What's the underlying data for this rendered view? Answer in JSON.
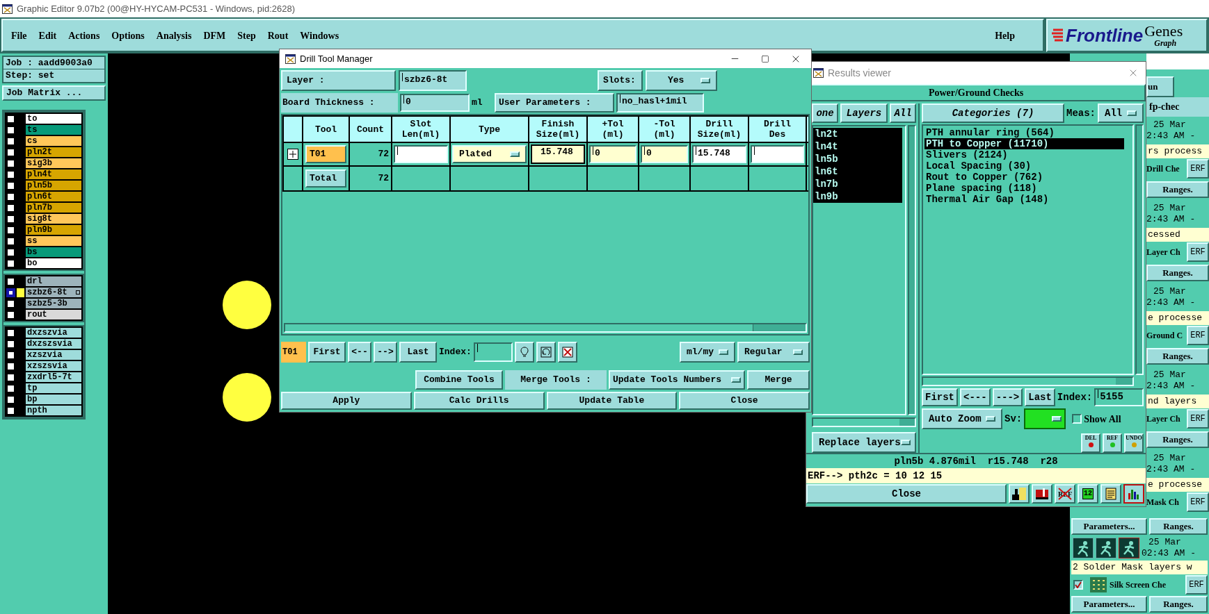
{
  "app": {
    "title": "Graphic Editor 9.07b2 (00@HY-HYCAM-PC531 - Windows, pid:2628)"
  },
  "menu": [
    "File",
    "Edit",
    "Actions",
    "Options",
    "Analysis",
    "DFM",
    "Step",
    "Rout",
    "Windows"
  ],
  "help": "Help",
  "logo": {
    "brand": "Frontline",
    "product": "Genes",
    "subtitle": "Graph"
  },
  "job": {
    "job": "Job : aadd9003a0",
    "step": "Step: set",
    "matrix": "Job Matrix ..."
  },
  "layer_groups": [
    {
      "layers": [
        {
          "name": "to",
          "color": "#ffffff",
          "selected": false,
          "displayed": false
        },
        {
          "name": "ts",
          "color": "#079a7a",
          "selected": false,
          "displayed": false
        },
        {
          "name": "cs",
          "color": "#ffc75a",
          "selected": false,
          "displayed": false
        },
        {
          "name": "pln2t",
          "color": "#d6a500",
          "selected": false,
          "displayed": false
        },
        {
          "name": "sig3b",
          "color": "#ffc75a",
          "selected": false,
          "displayed": false
        },
        {
          "name": "pln4t",
          "color": "#d6a500",
          "selected": false,
          "displayed": false
        },
        {
          "name": "pln5b",
          "color": "#d6a500",
          "selected": false,
          "displayed": false
        },
        {
          "name": "pln6t",
          "color": "#d6a500",
          "selected": false,
          "displayed": false
        },
        {
          "name": "pln7b",
          "color": "#d6a500",
          "selected": false,
          "displayed": false
        },
        {
          "name": "sig8t",
          "color": "#ffc75a",
          "selected": false,
          "displayed": false
        },
        {
          "name": "pln9b",
          "color": "#d6a500",
          "selected": false,
          "displayed": false
        },
        {
          "name": "ss",
          "color": "#ffc75a",
          "selected": false,
          "displayed": false
        },
        {
          "name": "bs",
          "color": "#079a7a",
          "selected": false,
          "displayed": false
        },
        {
          "name": "bo",
          "color": "#ffffff",
          "selected": false,
          "displayed": false
        }
      ]
    },
    {
      "layers": [
        {
          "name": "drl",
          "color": "#9db3bb",
          "selected": false,
          "displayed": false
        },
        {
          "name": "szbz6-8t",
          "color": "#9db3bb",
          "selected": true,
          "displayed": true
        },
        {
          "name": "szbz5-3b",
          "color": "#9db3bb",
          "selected": false,
          "displayed": false
        },
        {
          "name": "rout",
          "color": "#d9d9d9",
          "selected": false,
          "displayed": false
        }
      ]
    },
    {
      "layers": [
        {
          "name": "dxzszvia",
          "color": "#9edcdb",
          "selected": false,
          "displayed": false
        },
        {
          "name": "dxzszsvia",
          "color": "#9edcdb",
          "selected": false,
          "displayed": false
        },
        {
          "name": "xzszvia",
          "color": "#9edcdb",
          "selected": false,
          "displayed": false
        },
        {
          "name": "xzszsvia",
          "color": "#9edcdb",
          "selected": false,
          "displayed": false
        },
        {
          "name": "zxdrl5-7t",
          "color": "#9edcdb",
          "selected": false,
          "displayed": false
        },
        {
          "name": "tp",
          "color": "#9edcdb",
          "selected": false,
          "displayed": false
        },
        {
          "name": "bp",
          "color": "#9edcdb",
          "selected": false,
          "displayed": false
        },
        {
          "name": "npth",
          "color": "#9edcdb",
          "selected": false,
          "displayed": false
        }
      ]
    }
  ],
  "drill_tool_manager": {
    "title": "Drill Tool Manager",
    "layer_label": "Layer :",
    "layer": "szbz6-8t",
    "slots_label": "Slots:",
    "slots": "Yes",
    "thickness_label": "Board Thickness :",
    "thickness": "0",
    "thickness_unit": "ml",
    "user_params_label": "User Parameters :",
    "user_params": "no_hasl+1mil",
    "columns": [
      "Tool",
      "Count",
      "Slot\nLen(ml)",
      "Type",
      "Finish\nSize(ml)",
      "+Tol\n(ml)",
      "-Tol\n(ml)",
      "Drill\nSize(ml)",
      "Drill\nDes"
    ],
    "rows": [
      {
        "kind": "tool",
        "tool": "T01",
        "count": "72",
        "type": "Plated",
        "finish": "15.748",
        "plus_tol": "0",
        "minus_tol": "0",
        "drill_size": "15.748"
      },
      {
        "kind": "total",
        "tool": "Total",
        "count": "72"
      }
    ],
    "current": "T01",
    "nav": [
      "First",
      "<--",
      "-->",
      "Last"
    ],
    "index_label": "Index:",
    "units": "ml/my",
    "mode": "Regular",
    "combine": "Combine Tools",
    "merge_label": "Merge Tools :",
    "merge_mode": "Update Tools Numbers",
    "merge": "Merge",
    "actions": [
      "Apply",
      "Calc Drills",
      "Update Table",
      "Close"
    ]
  },
  "results_viewer": {
    "title": "Results viewer",
    "heading": "Power/Ground Checks",
    "layer_buttons": [
      "one",
      "Layers",
      "All"
    ],
    "layers": [
      {
        "name": "ln2t",
        "selected": true
      },
      {
        "name": "ln4t",
        "selected": true
      },
      {
        "name": "ln5b",
        "selected": true
      },
      {
        "name": "ln6t",
        "selected": true
      },
      {
        "name": "ln7b",
        "selected": true
      },
      {
        "name": "ln9b",
        "selected": true
      }
    ],
    "categories_button": "Categories (7)",
    "meas_label": "Meas:",
    "meas": "All",
    "categories": [
      {
        "label": "PTH annular ring (564)",
        "selected": false
      },
      {
        "label": "PTH to Copper (11710)",
        "selected": true
      },
      {
        "label": "Slivers (2124)",
        "selected": false
      },
      {
        "label": "Local Spacing (30)",
        "selected": false
      },
      {
        "label": "Rout to Copper (762)",
        "selected": false
      },
      {
        "label": "Plane spacing (118)",
        "selected": false
      },
      {
        "label": "Thermal Air Gap (148)",
        "selected": false
      }
    ],
    "nav": [
      "First",
      "<---",
      "--->",
      "Last"
    ],
    "index_label": "Index:",
    "index": "5155",
    "zoom_mode": "Auto Zoom",
    "sv_label": "Sv:",
    "show_all": {
      "label": "Show All",
      "checked": false
    },
    "tool_buttons": [
      "DEL",
      "REF",
      "UNDO"
    ],
    "replace": "Replace layers",
    "status": "pln5b 4.876mil  r15.748  r28",
    "erf": "ERF--> pth2c = 10 12 15",
    "close": "Close",
    "icon_texts": [
      "REF",
      "12"
    ]
  },
  "checks_panel": {
    "tab": "un",
    "title": "fp-chec",
    "upper_items": [
      {
        "kind": "date",
        "date": "25 Mar",
        "time": "2:43 AM -"
      },
      {
        "kind": "message",
        "text": "rs process"
      },
      {
        "kind": "check",
        "name": "Drill Che",
        "erf": "ERF"
      },
      {
        "kind": "ranges",
        "ranges": "Ranges."
      },
      {
        "kind": "date",
        "date": "25 Mar",
        "time": "2:43 AM -"
      },
      {
        "kind": "message",
        "text": "cessed"
      },
      {
        "kind": "check",
        "name": "Layer Ch",
        "erf": "ERF"
      },
      {
        "kind": "ranges",
        "ranges": "Ranges."
      },
      {
        "kind": "date",
        "date": "25 Mar",
        "time": "2:43 AM -"
      },
      {
        "kind": "message",
        "text": "e processe"
      },
      {
        "kind": "check",
        "name": "Ground C",
        "erf": "ERF"
      },
      {
        "kind": "ranges",
        "ranges": "Ranges."
      },
      {
        "kind": "date",
        "date": "25 Mar",
        "time": "2:43 AM -"
      },
      {
        "kind": "message",
        "text": "nd layers"
      },
      {
        "kind": "check",
        "name": "Layer Ch",
        "erf": "ERF"
      },
      {
        "kind": "ranges",
        "ranges": "Ranges."
      },
      {
        "kind": "date",
        "date": "25 Mar",
        "time": "2:43 AM -"
      },
      {
        "kind": "message",
        "text": "e processe"
      },
      {
        "kind": "check",
        "name": "Mask Ch",
        "erf": "ERF"
      }
    ],
    "lower_items": [
      {
        "kind": "ranges",
        "parameters": "Parameters...",
        "ranges": "Ranges."
      },
      {
        "kind": "run",
        "date": "25 Mar",
        "time": "02:43 AM -"
      },
      {
        "kind": "message",
        "text": "2 Solder Mask layers w"
      },
      {
        "kind": "check",
        "name": "Silk Screen Che",
        "erf": "ERF",
        "checked": true
      },
      {
        "kind": "ranges",
        "parameters": "Parameters...",
        "ranges": "Ranges."
      }
    ]
  }
}
